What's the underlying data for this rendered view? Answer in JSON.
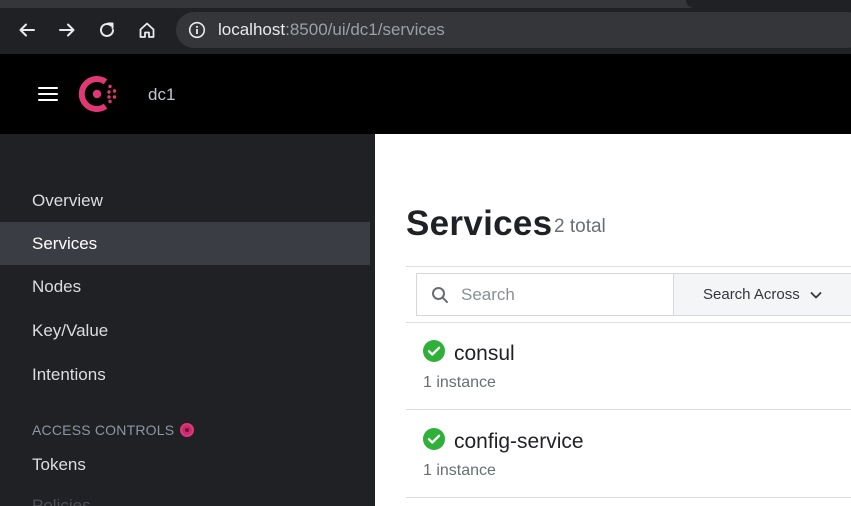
{
  "browser": {
    "url_host": "localhost",
    "url_path": ":8500/ui/dc1/services"
  },
  "header": {
    "datacenter": "dc1",
    "logo": "consul-logo",
    "brand_color": "#e03875"
  },
  "sidebar": {
    "items": [
      {
        "label": "Overview"
      },
      {
        "label": "Services"
      },
      {
        "label": "Nodes"
      },
      {
        "label": "Key/Value"
      },
      {
        "label": "Intentions"
      }
    ],
    "active_item": "Services",
    "section_label": "ACCESS CONTROLS",
    "acl_items": [
      {
        "label": "Tokens"
      },
      {
        "label": "Policies"
      }
    ]
  },
  "main": {
    "title": "Services",
    "total": "2 total",
    "search": {
      "placeholder": "Search",
      "value": ""
    },
    "search_across_label": "Search Across",
    "services": [
      {
        "name": "consul",
        "instances": "1 instance",
        "status": "passing"
      },
      {
        "name": "config-service",
        "instances": "1 instance",
        "status": "passing"
      }
    ],
    "status_color": "#2eb039"
  }
}
